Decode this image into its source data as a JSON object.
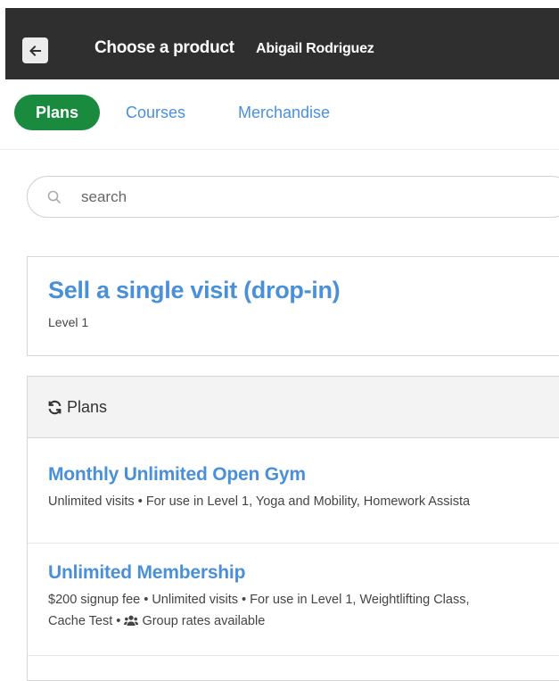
{
  "header": {
    "title": "Choose a product",
    "customer_name": "Abigail Rodriguez",
    "back_icon": "arrow-left-icon"
  },
  "tabs": [
    {
      "label": "Plans",
      "active": true
    },
    {
      "label": "Courses",
      "active": false
    },
    {
      "label": "Merchandise",
      "active": false
    }
  ],
  "search": {
    "placeholder": "search",
    "value": "",
    "icon": "search-icon"
  },
  "dropin": {
    "title": "Sell a single visit (drop-in)",
    "subtitle": "Level 1"
  },
  "plans_section": {
    "header_label": "Plans",
    "header_icon": "refresh-icon",
    "items": [
      {
        "name": "Monthly Unlimited Open Gym",
        "description": "Unlimited visits • For use in Level 1, Yoga and Mobility, Homework Assista"
      },
      {
        "name": "Unlimited Membership",
        "description_line1": "$200 signup fee • Unlimited visits • For use in Level 1, Weightlifting Class,",
        "description_line2_prefix": "Cache Test • ",
        "description_line2_suffix": "Group rates available",
        "group_icon": "users-icon"
      }
    ]
  },
  "colors": {
    "topbar": "#2f2f2f",
    "active_tab": "#1a8b3e",
    "link": "#4a90d9"
  }
}
